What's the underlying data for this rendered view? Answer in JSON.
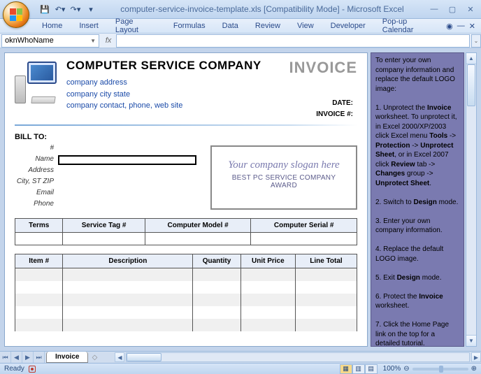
{
  "window": {
    "title": "computer-service-invoice-template.xls  [Compatibility Mode] - Microsoft Excel"
  },
  "qat": {
    "save": "💾",
    "undo": "↶",
    "redo": "↷"
  },
  "ribbon": {
    "tabs": [
      "Home",
      "Insert",
      "Page Layout",
      "Formulas",
      "Data",
      "Review",
      "View",
      "Developer",
      "Pop-up Calendar"
    ]
  },
  "namebox": "oknWhoName",
  "fx": "fx",
  "invoice": {
    "company_name": "COMPUTER SERVICE COMPANY",
    "addr1": "company address",
    "addr2": "company city state",
    "addr3": "company contact, phone, web site",
    "title": "INVOICE",
    "date_lbl": "DATE:",
    "invno_lbl": "INVOICE #:",
    "billto_title": "BILL TO:",
    "billto_labels": {
      "num": "#",
      "name": "Name",
      "address": "Address",
      "csz": "City, ST ZIP",
      "email": "Email",
      "phone": "Phone"
    },
    "slogan1": "Your company slogan here",
    "slogan2": "BEST PC SERVICE COMPANY AWARD",
    "tbl1": {
      "h1": "Terms",
      "h2": "Service Tag #",
      "h3": "Computer Model #",
      "h4": "Computer Serial #"
    },
    "tbl2": {
      "h1": "Item #",
      "h2": "Description",
      "h3": "Quantity",
      "h4": "Unit Price",
      "h5": "Line Total"
    }
  },
  "sidepanel": {
    "p0": "To enter your own company information and replace the default LOGO image:",
    "p1a": "1. Unprotect the ",
    "p1b": "Invoice",
    "p1c": " worksheet. To unprotect it, in Excel 2000/XP/2003 click Excel menu ",
    "p1d": "Tools",
    "p1e": " -> ",
    "p1f": "Protection",
    "p1g": " -> ",
    "p1h": "Unprotect Sheet",
    "p1i": ", or in Excel 2007 click ",
    "p1j": "Review",
    "p1k": " tab -> ",
    "p1l": "Changes",
    "p1m": " group -> ",
    "p1n": "Unprotect Sheet",
    "p1o": ".",
    "p2a": "2. Switch to ",
    "p2b": "Design",
    "p2c": " mode.",
    "p3": "3. Enter your own company information.",
    "p4": "4. Replace the default LOGO image.",
    "p5a": "5. Exit ",
    "p5b": "Design",
    "p5c": " mode.",
    "p6a": "6. Protect the ",
    "p6b": "Invoice",
    "p6c": " worksheet.",
    "p7": "7. Click the Home Page link on the top for a detailed tutorial."
  },
  "sheettab": "Invoice",
  "status": {
    "ready": "Ready",
    "zoom": "100%"
  }
}
